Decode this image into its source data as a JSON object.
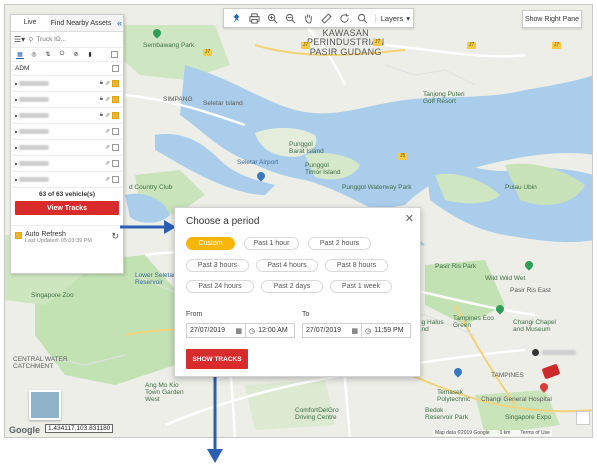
{
  "map": {
    "labels": {
      "kawasan": "KAWASAN\nPERINDUSTRIAN\nPASIR GUDANG",
      "sembawang_park": "Sembawang Park",
      "simpang": "SIMPANG",
      "seletar_island": "Seletar Island",
      "seletar_airport": "Seletar Airport",
      "punggol_barat": "Punggol\nBarat Island",
      "punggol_timor": "Punggol\nTimor Island",
      "punggol_waterway": "Punggol Waterway Park",
      "tanjong_puteri": "Tanjong Puteri\nGolf Resort",
      "pulau_ubin": "Pulau Ubin",
      "country_club": "d Country Club",
      "central_water": "CENTRAL WATER\nCATCHMENT",
      "pasir_ris_park": "Pasir Ris Park",
      "wild_wild_wet": "Wild Wild Wet",
      "tampines_eco": "Tampines Eco\nGreen",
      "changi_chapel": "Changi Chapel\nand Museum",
      "tampines": "TAMPINES",
      "temasek_poly": "Temasek\nPolytechnic",
      "bedok_reservoir": "Bedok\nReservoir Park",
      "comfort_delgro": "ComfortDelGro\nDriving Centre",
      "singapore_expo": "Singapore Expo",
      "changi_general": "Changi General Hospital",
      "singapore_zoo": "Singapore Zoo",
      "lower_seletar": "Lower Seletar\nReservoir",
      "pasir_ris_east": "Pasir Ris East",
      "ang_mo_kio": "Ang Mo Kio\nTown Garden\nWest",
      "lorong_halus": "Lorong Halus\nWetland"
    },
    "road_tags": [
      "J7",
      "J7",
      "J7",
      "J7",
      "J7",
      "J5",
      "J5"
    ],
    "footer": {
      "data": "Map data ©2019 Google",
      "scale": "1 km",
      "terms": "Terms of Use",
      "report": "Report a map error"
    },
    "google": "Google",
    "coords": "1.434117,103.831180"
  },
  "toolbar": {
    "layers_label": "Layers",
    "show_right_pane": "Show Right Pane"
  },
  "panel": {
    "tab_live": "Live",
    "tab_nearby": "Find Nearby Assets",
    "search_placeholder": "Truck ID...",
    "group_label": "ADM",
    "vehicle_count": "63 of 63 vehicle(s)",
    "view_tracks": "View Tracks",
    "auto_refresh": "Auto Refresh",
    "last_updated": "Last Updated: 05:03:39 PM"
  },
  "dialog": {
    "title": "Choose a period",
    "options": [
      "Custom",
      "Past 1 hour",
      "Past 2 hours",
      "Past 3 hours",
      "Past 4 hours",
      "Past 8 hours",
      "Past 24 hours",
      "Past 2 days",
      "Past 1 week"
    ],
    "from_label": "From",
    "to_label": "To",
    "from_date": "27/07/2019",
    "from_time": "12:00 AM",
    "to_date": "27/07/2019",
    "to_time": "11:59 PM",
    "show_tracks": "SHOW TRACKS"
  },
  "colors": {
    "accent_red": "#d92b2b",
    "accent_yellow": "#f6b60c",
    "arrow_blue": "#2a5fb3",
    "water": "#a9cdea",
    "park": "#c3e2b4"
  }
}
